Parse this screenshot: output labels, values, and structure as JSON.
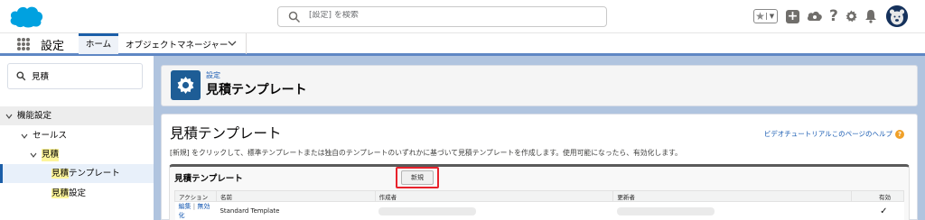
{
  "header": {
    "search_placeholder": "[設定] を検索"
  },
  "app_nav": {
    "app_name": "設定",
    "tab_home": "ホーム",
    "tab_object_manager": "オブジェクトマネージャー"
  },
  "sidebar": {
    "search_value": "見積",
    "items": [
      {
        "label": "機能設定"
      },
      {
        "label": "セールス"
      },
      {
        "label": "見積"
      },
      {
        "label_hl": "見積",
        "label_rest": "テンプレート"
      },
      {
        "label_hl": "見積",
        "label_rest": "設定"
      }
    ]
  },
  "page_header": {
    "breadcrumb": "設定",
    "title": "見積テンプレート"
  },
  "content": {
    "title": "見積テンプレート",
    "help_link": "ビデオチュートリアルこのページのヘルプ",
    "help_icon": "?",
    "description": "[新規] をクリックして、標準テンプレートまたは独自のテンプレートのいずれかに基づいて見積テンプレートを作成します。使用可能になったら、有効化します。"
  },
  "related_list": {
    "title": "見積テンプレート",
    "new_button": "新規",
    "columns": {
      "action": "アクション",
      "name": "名前",
      "created_by": "作成者",
      "modified_by": "更新者",
      "active": "有効"
    },
    "rows": [
      {
        "action_edit": "編集",
        "action_sep": "|",
        "action_deactivate": "無効化",
        "name": "Standard Template",
        "active": "✓"
      }
    ]
  },
  "colors": {
    "accent_blue": "#1b5ea8",
    "highlight_red": "#e8222c",
    "search_highlight": "#fdf59b"
  },
  "icons": [
    "salesforce-cloud-logo",
    "search-icon",
    "favorites-star-icon",
    "add-icon",
    "cloud-icon",
    "help-icon",
    "gear-icon",
    "bell-icon",
    "avatar-icon",
    "app-launcher-icon",
    "chevron-down-icon",
    "setup-gear-icon"
  ]
}
